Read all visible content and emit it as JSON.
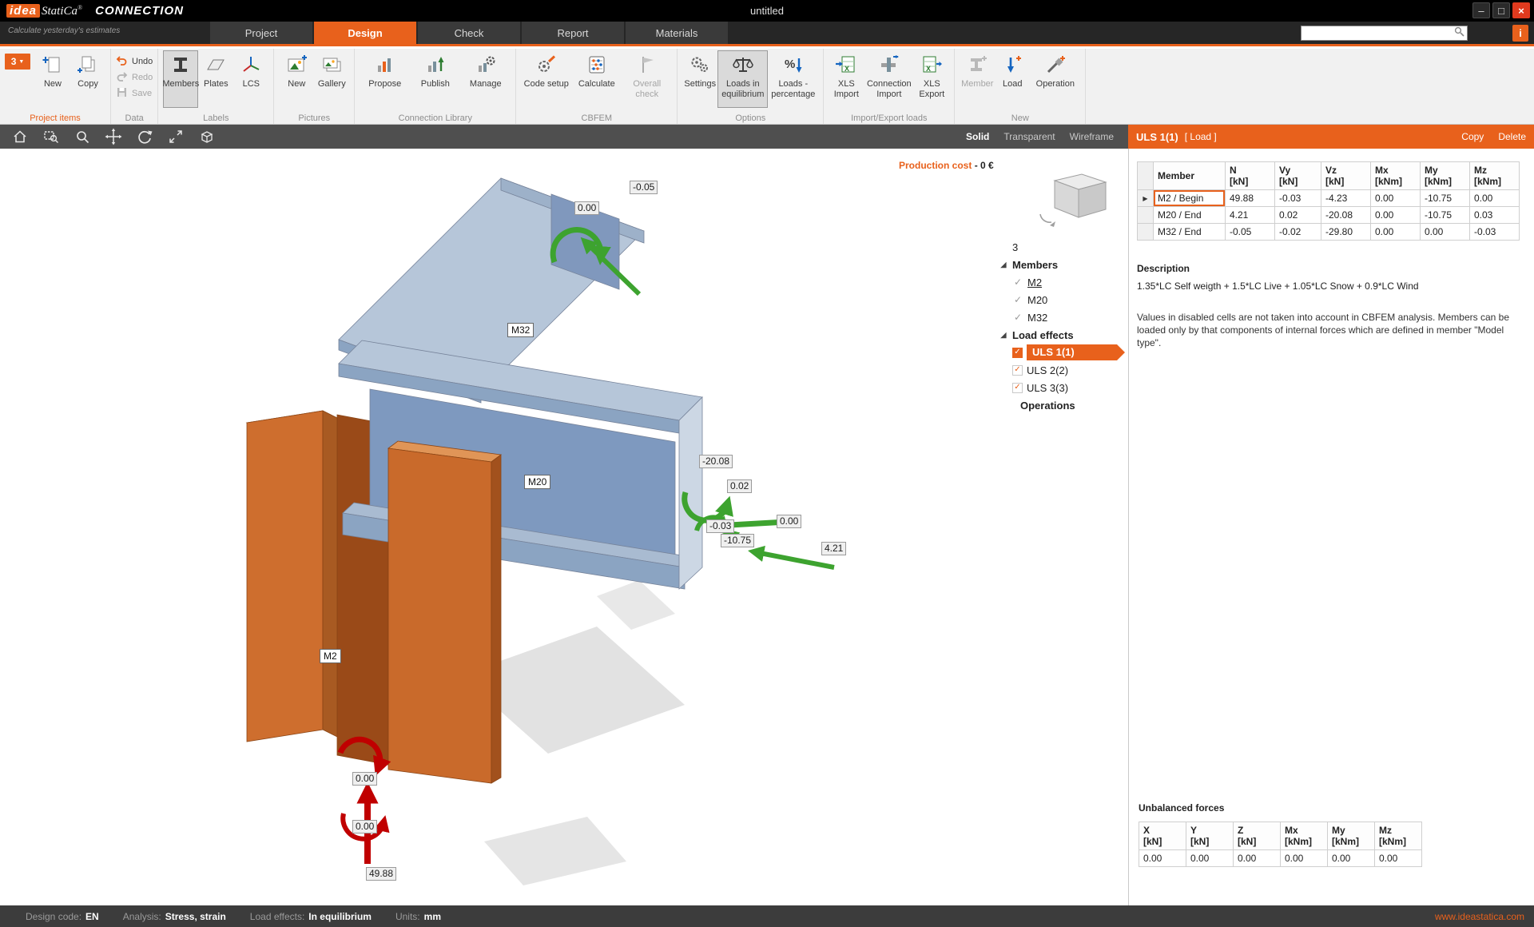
{
  "colors": {
    "accent": "#E8611C",
    "steel_blue": "#7E99BF",
    "steel_orange": "#C96A2B",
    "load_green": "#3DA32F",
    "load_red": "#C00000"
  },
  "window": {
    "logo_primary": "idea",
    "logo_secondary": "StatiCa",
    "logo_reg": "®",
    "app_name": "CONNECTION",
    "tagline": "Calculate yesterday's estimates",
    "document_title": "untitled",
    "minimize": "–",
    "maximize": "□",
    "close": "×",
    "info": "i"
  },
  "tabs": [
    {
      "label": "Project"
    },
    {
      "label": "Design"
    },
    {
      "label": "Check"
    },
    {
      "label": "Report"
    },
    {
      "label": "Materials"
    }
  ],
  "ribbon": {
    "project_selector": "3",
    "dropdown_arrow": "▼",
    "groups": [
      {
        "label": "Project items",
        "buttons": [
          {
            "label": "New"
          },
          {
            "label": "Copy"
          }
        ]
      },
      {
        "label": "Data",
        "buttons": [
          {
            "label": "Undo"
          },
          {
            "label": "Redo"
          },
          {
            "label": "Save"
          }
        ]
      },
      {
        "label": "Labels",
        "buttons": [
          {
            "label": "Members"
          },
          {
            "label": "Plates"
          },
          {
            "label": "LCS"
          }
        ]
      },
      {
        "label": "Pictures",
        "buttons": [
          {
            "label": "New"
          },
          {
            "label": "Gallery"
          }
        ]
      },
      {
        "label": "Connection Library",
        "buttons": [
          {
            "label": "Propose"
          },
          {
            "label": "Publish"
          },
          {
            "label": "Manage"
          }
        ]
      },
      {
        "label": "CBFEM",
        "buttons": [
          {
            "label": "Code setup"
          },
          {
            "label": "Calculate"
          },
          {
            "label": "Overall check"
          }
        ]
      },
      {
        "label": "Options",
        "buttons": [
          {
            "label": "Settings"
          },
          {
            "label": "Loads in equilibrium"
          },
          {
            "label": "Loads - percentage"
          }
        ]
      },
      {
        "label": "Import/Export loads",
        "buttons": [
          {
            "label": "XLS Import"
          },
          {
            "label": "Connection Import"
          },
          {
            "label": "XLS Export"
          }
        ]
      },
      {
        "label": "New",
        "buttons": [
          {
            "label": "Member"
          },
          {
            "label": "Load"
          },
          {
            "label": "Operation"
          }
        ]
      }
    ]
  },
  "viewport_toolbar": {
    "modes": [
      "Solid",
      "Transparent",
      "Wireframe"
    ]
  },
  "scene": {
    "production_cost_label": "Production cost",
    "production_cost_value": "- 0 €",
    "labels": {
      "column": "M2",
      "beam": "M20",
      "top_beam": "M32"
    },
    "loads_m32": [
      "-0.05",
      "0.00"
    ],
    "loads_m20": [
      "-20.08",
      "0.02",
      "-0.03",
      "-10.75",
      "0.00",
      "4.21"
    ],
    "loads_m2": [
      "0.00",
      "0.00",
      "49.88"
    ]
  },
  "tree": {
    "count": "3",
    "members_header": "Members",
    "members": [
      "M2",
      "M20",
      "M32"
    ],
    "loads_header": "Load effects",
    "cases": [
      "ULS 1(1)",
      "ULS 2(2)",
      "ULS 3(3)"
    ],
    "operations_header": "Operations",
    "check_glyph": "✓"
  },
  "panel": {
    "title": "ULS 1(1)",
    "subtitle": "[ Load ]",
    "copy_label": "Copy",
    "delete_label": "Delete",
    "load_table": {
      "headers": [
        "Member",
        "N",
        "Vy",
        "Vz",
        "Mx",
        "My",
        "Mz"
      ],
      "units": [
        "",
        "[kN]",
        "[kN]",
        "[kN]",
        "[kNm]",
        "[kNm]",
        "[kNm]"
      ],
      "rows": [
        {
          "member": "M2 / Begin",
          "values": [
            "49.88",
            "-0.03",
            "-4.23",
            "0.00",
            "-10.75",
            "0.00"
          ]
        },
        {
          "member": "M20 / End",
          "values": [
            "4.21",
            "0.02",
            "-20.08",
            "0.00",
            "-10.75",
            "0.03"
          ]
        },
        {
          "member": "M32 / End",
          "values": [
            "-0.05",
            "-0.02",
            "-29.80",
            "0.00",
            "0.00",
            "-0.03"
          ]
        }
      ]
    },
    "description_header": "Description",
    "description": "1.35*LC Self weigth + 1.5*LC Live + 1.05*LC Snow + 0.9*LC Wind",
    "note": "Values in disabled cells are not taken into account in CBFEM analysis. Members can be loaded only by that components of internal forces which are defined in member \"Model type\".",
    "unbalanced_header": "Unbalanced forces",
    "unbalanced_table": {
      "headers": [
        "X",
        "Y",
        "Z",
        "Mx",
        "My",
        "Mz"
      ],
      "units": [
        "[kN]",
        "[kN]",
        "[kN]",
        "[kNm]",
        "[kNm]",
        "[kNm]"
      ],
      "values": [
        "0.00",
        "0.00",
        "0.00",
        "0.00",
        "0.00",
        "0.00"
      ]
    }
  },
  "statusbar": {
    "items": [
      {
        "label": "Design code:",
        "value": "EN"
      },
      {
        "label": "Analysis:",
        "value": "Stress, strain"
      },
      {
        "label": "Load effects:",
        "value": "In equilibrium"
      },
      {
        "label": "Units:",
        "value": "mm"
      }
    ],
    "link": "www.ideastatica.com"
  }
}
